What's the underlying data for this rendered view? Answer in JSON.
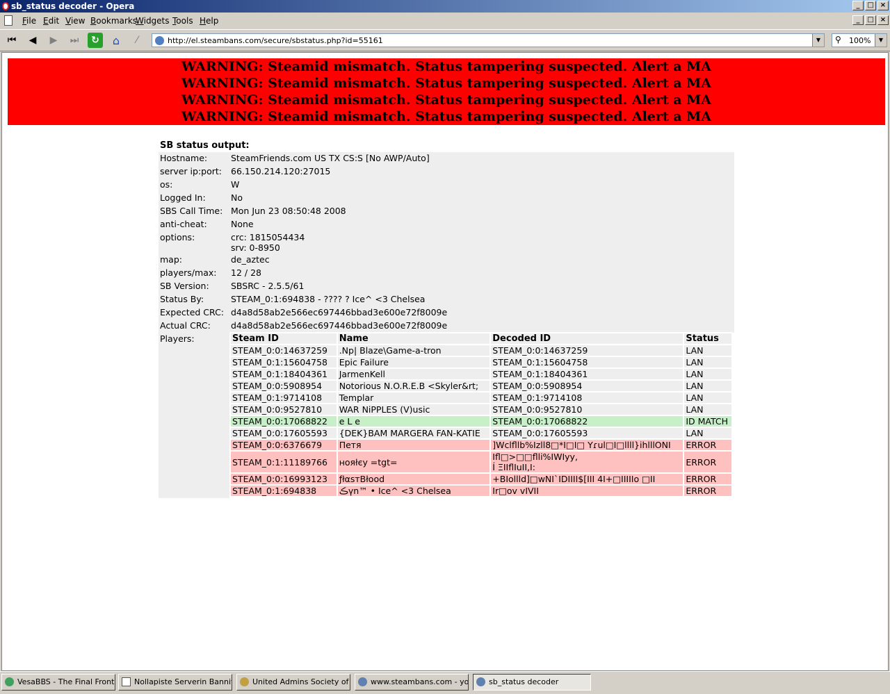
{
  "window": {
    "title": "sb_status decoder - Opera"
  },
  "window_buttons": {
    "minimize": "_",
    "maximize": "□",
    "close": "×"
  },
  "menu": [
    "File",
    "Edit",
    "View",
    "Bookmarks",
    "Widgets",
    "Tools",
    "Help"
  ],
  "nav": {
    "url": "http://el.steambans.com/secure/sbstatus.php?id=55161",
    "zoom": "100%"
  },
  "warning_lines": [
    "WARNING: Steamid mismatch. Status tampering suspected. Alert a MA",
    "WARNING: Steamid mismatch. Status tampering suspected. Alert a MA",
    "WARNING: Steamid mismatch. Status tampering suspected. Alert a MA",
    "WARNING: Steamid mismatch. Status tampering suspected. Alert a MA"
  ],
  "status": {
    "heading": "SB status output:",
    "fields": [
      {
        "label": "Hostname:",
        "value": "SteamFriends.com US TX CS:S [No AWP/Auto]"
      },
      {
        "label": "server ip:port:",
        "value": "66.150.214.120:27015"
      },
      {
        "label": "os:",
        "value": "W"
      },
      {
        "label": "Logged In:",
        "value": "No"
      },
      {
        "label": "SBS Call Time:",
        "value": "Mon Jun 23 08:50:48 2008"
      },
      {
        "label": "anti-cheat:",
        "value": "None"
      },
      {
        "label": "options:",
        "value": "crc: 1815054434",
        "value2": "srv: 0-8950"
      },
      {
        "label": "map:",
        "value": "de_aztec"
      },
      {
        "label": "players/max:",
        "value": "12 / 28"
      },
      {
        "label": "SB Version:",
        "value": "SBSRC - 2.5.5/61"
      },
      {
        "label": "Status By:",
        "value": "STEAM_0:1:694838 - ???? ? Ice^ <3 Chelsea"
      },
      {
        "label": "Expected CRC:",
        "value": "d4a8d58ab2e566ec697446bbad3e600e72f8009e"
      },
      {
        "label": "Actual CRC:",
        "value": "d4a8d58ab2e566ec697446bbad3e600e72f8009e"
      }
    ],
    "players_label": "Players:"
  },
  "players": {
    "headers": [
      "Steam ID",
      "Name",
      "Decoded ID",
      "Status"
    ],
    "rows": [
      {
        "steam_id": "STEAM_0:0:14637259",
        "name": ".Np| Blaze\\Game-a-tron",
        "decoded": "STEAM_0:0:14637259",
        "status": "LAN"
      },
      {
        "steam_id": "STEAM_0:1:15604758",
        "name": "Epic Failure",
        "decoded": "STEAM_0:1:15604758",
        "status": "LAN"
      },
      {
        "steam_id": "STEAM_0:1:18404361",
        "name": "JarmenKell",
        "decoded": "STEAM_0:1:18404361",
        "status": "LAN"
      },
      {
        "steam_id": "STEAM_0:0:5908954",
        "name": "Notorious N.O.R.E.B <Skyler&rt;",
        "decoded": "STEAM_0:0:5908954",
        "status": "LAN"
      },
      {
        "steam_id": "STEAM_0:1:9714108",
        "name": "Templar",
        "decoded": "STEAM_0:1:9714108",
        "status": "LAN"
      },
      {
        "steam_id": "STEAM_0:0:9527810",
        "name": "WAR NiPPLES (V)usic",
        "decoded": "STEAM_0:0:9527810",
        "status": "LAN"
      },
      {
        "steam_id": "STEAM_0:0:17068822",
        "name": "e L e",
        "decoded": "STEAM_0:0:17068822",
        "status": "ID MATCH"
      },
      {
        "steam_id": "STEAM_0:0:17605593",
        "name": "{DEK}BAM MARGERA FAN-KATIE",
        "decoded": "STEAM_0:0:17605593",
        "status": "LAN"
      },
      {
        "steam_id": "STEAM_0:0:6376679",
        "name": "Петя",
        "decoded": "]Wclfllb%Izll8□*I□I□ Yɾul□I□llll}ihlllONI",
        "status": "ERROR"
      },
      {
        "steam_id": "STEAM_0:1:11189766",
        "name": "нояłєу =tgt=",
        "decoded": "Ifl□>□□flli%IWIyy,",
        "decoded2": "Í ΞIIflIuII,I:",
        "status": "ERROR"
      },
      {
        "steam_id": "STEAM_0:0:16993123",
        "name": "ƒłαѕтBłood",
        "decoded": "+BIollld]□wNI`IDIIII$[III 4I+□IIIIIo □II",
        "status": "ERROR"
      },
      {
        "steam_id": "STEAM_0:1:694838",
        "name": "ڪүn™ • Ice^ <3 Chelsea",
        "decoded": "Ir□ov vIVII",
        "status": "ERROR"
      }
    ]
  },
  "taskbar": [
    {
      "label": "VesaBBS - The Final Fronti...",
      "icon": "bbs-icon"
    },
    {
      "label": "Nollapiste Serverin Bannit",
      "icon": "document-icon"
    },
    {
      "label": "United Admins Society of F...",
      "icon": "shield-icon"
    },
    {
      "label": "www.steambans.com - yo...",
      "icon": "opera-icon"
    },
    {
      "label": "sb_status decoder",
      "icon": "opera-icon",
      "active": true
    }
  ]
}
